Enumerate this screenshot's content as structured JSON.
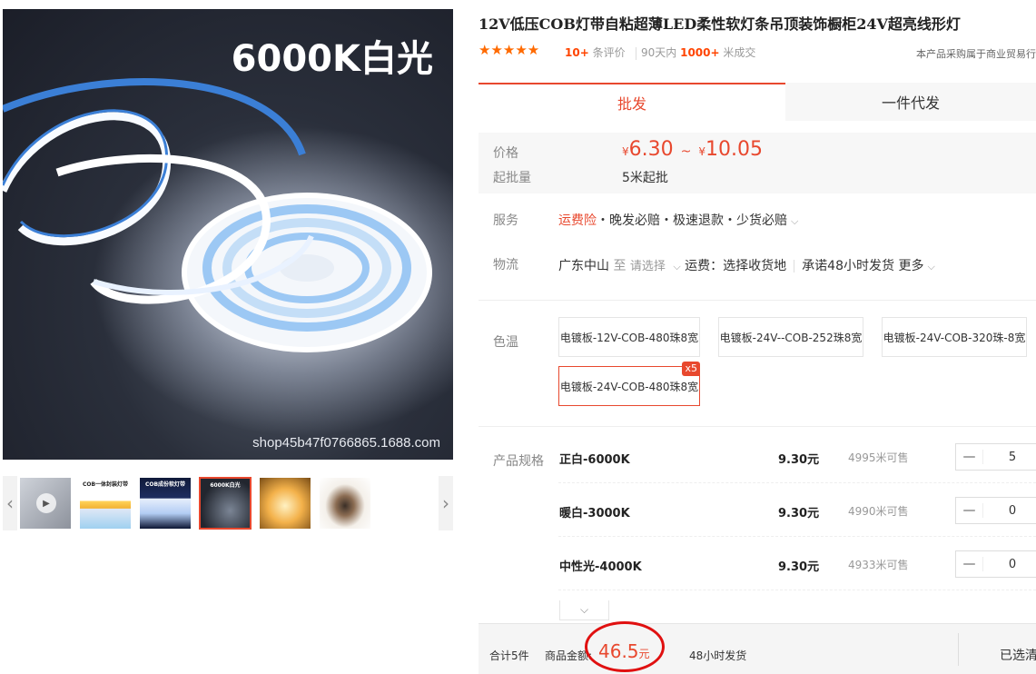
{
  "gallery": {
    "badge": "6000K白光",
    "watermark": "shop45b47f0766865.1688.com",
    "thumbs": [
      {
        "text": ""
      },
      {
        "text": "COB一体封装灯带"
      },
      {
        "text": "COB成份软灯带"
      },
      {
        "text": "6000K白光"
      },
      {
        "text": ""
      },
      {
        "text": ""
      }
    ],
    "prev": "‹",
    "next": "›"
  },
  "product": {
    "title": "12V低压COB灯带自粘超薄LED柔性软灯条吊顶装饰橱柜24V超亮线形灯",
    "stars": "★★★★★",
    "review_count": "10+",
    "review_label": "条评价",
    "sales_period": "90天内",
    "sales_count": "1000+",
    "sales_unit": "米成交",
    "note": "本产品采购属于商业贸易行"
  },
  "tabs": {
    "wholesale": "批发",
    "dropship": "一件代发"
  },
  "price": {
    "label": "价格",
    "currency": "¥",
    "min": "6.30",
    "tilde": "~",
    "max": "10.05",
    "moq_label": "起批量",
    "moq_value": "5米起批"
  },
  "service": {
    "label": "服务",
    "highlight": "运费险",
    "items": "・晚发必赔・极速退款・少货必赔",
    "chevron": "⌵"
  },
  "logistics": {
    "label": "物流",
    "origin": "广东中山",
    "to": "至",
    "select": "请选择",
    "chevron": "⌵",
    "fee": "运费：选择收货地",
    "promise": "承诺48小时发货",
    "more": "更多"
  },
  "color_temp": {
    "label": "色温",
    "options": [
      {
        "label": "电镀板-12V-COB-480珠8宽"
      },
      {
        "label": "电镀板-24V--COB-252珠8宽"
      },
      {
        "label": "电镀板-24V-COB-320珠-8宽"
      },
      {
        "label": "电镀板-24V-COB-480珠8宽",
        "badge": "x5"
      }
    ]
  },
  "specs": {
    "label": "产品规格",
    "minus": "—",
    "rows": [
      {
        "name": "正白-6000K",
        "price": "9.30元",
        "stock": "4995米可售",
        "qty": "5"
      },
      {
        "name": "暖白-3000K",
        "price": "9.30元",
        "stock": "4990米可售",
        "qty": "0"
      },
      {
        "name": "中性光-4000K",
        "price": "9.30元",
        "stock": "4933米可售",
        "qty": "0"
      }
    ],
    "expand": "⌵"
  },
  "footer": {
    "total": "合计5件",
    "amount_label": "商品金额:",
    "amount": "46.5",
    "amount_unit": "元",
    "ship": "48小时发货",
    "selected": "已选清单"
  },
  "colors": {
    "accent": "#e8482e",
    "star": "#ff6a00",
    "annotation": "#e01010"
  }
}
